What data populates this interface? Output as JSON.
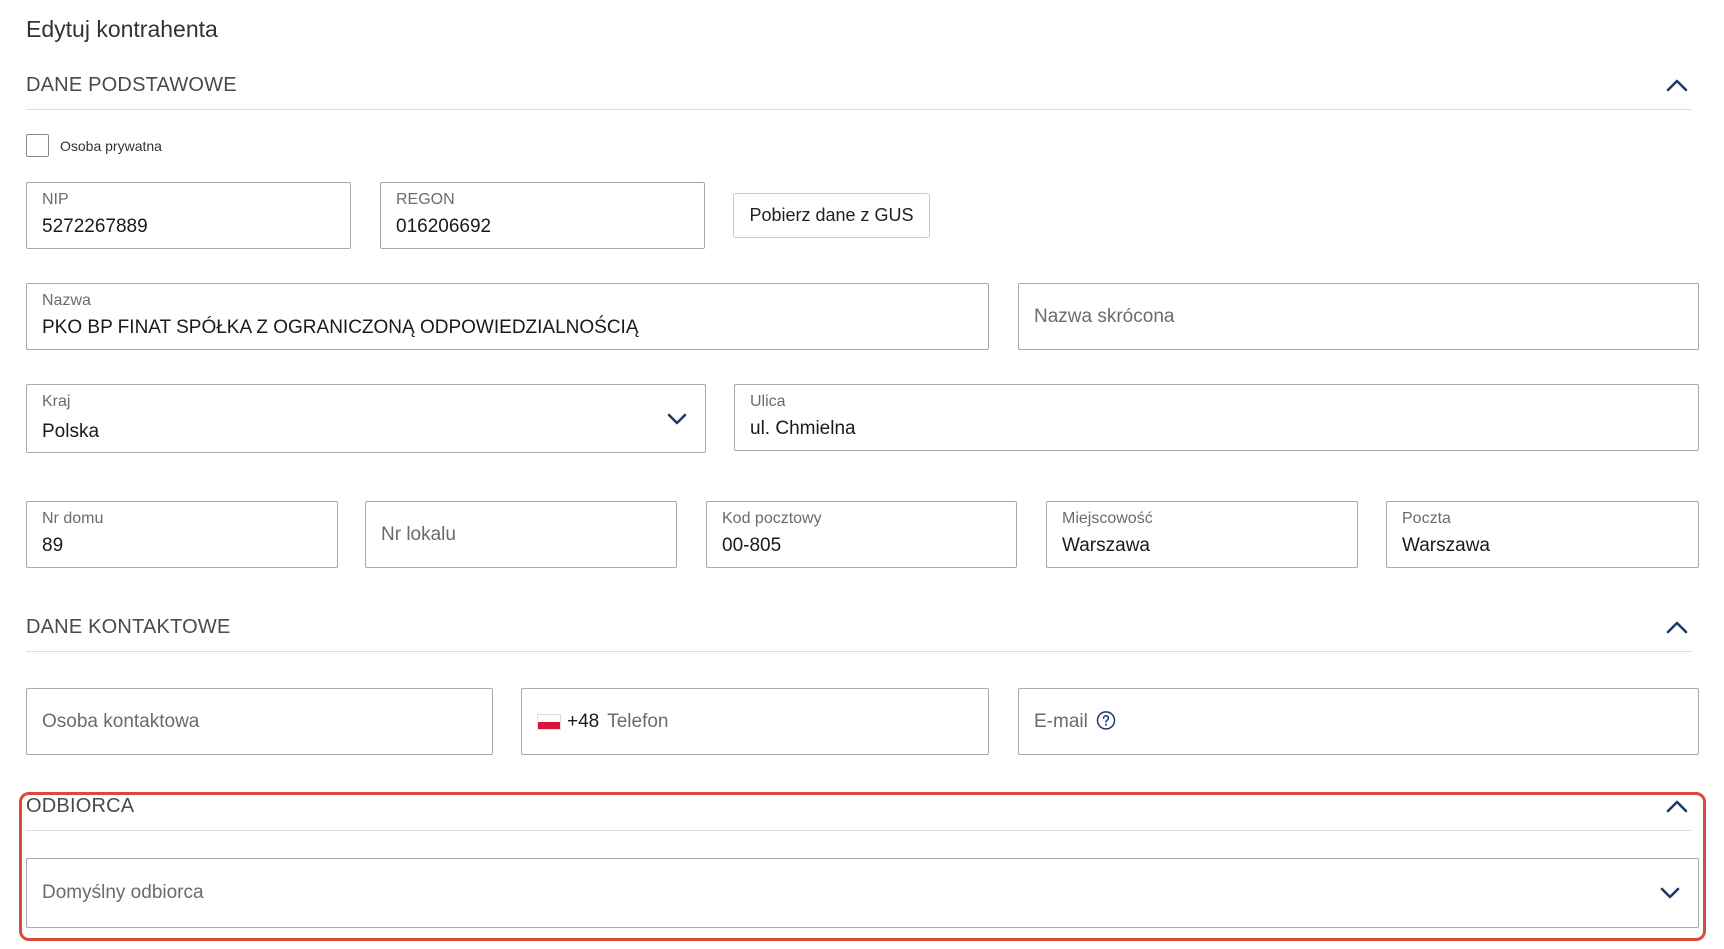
{
  "page": {
    "title": "Edytuj kontrahenta"
  },
  "sections": {
    "basic": {
      "label": "DANE PODSTAWOWE"
    },
    "contact": {
      "label": "DANE KONTAKTOWE"
    },
    "recipient": {
      "label": "ODBIORCA"
    }
  },
  "private_person": {
    "label": "Osoba prywatna",
    "checked": false
  },
  "fields": {
    "nip": {
      "label": "NIP",
      "value": "5272267889"
    },
    "regon": {
      "label": "REGON",
      "value": "016206692"
    },
    "nazwa": {
      "label": "Nazwa",
      "value": "PKO BP FINAT SPÓŁKA Z OGRANICZONĄ ODPOWIEDZIALNOŚCIĄ"
    },
    "nazwa_skrocona": {
      "placeholder": "Nazwa skrócona"
    },
    "kraj": {
      "label": "Kraj",
      "value": "Polska"
    },
    "ulica": {
      "label": "Ulica",
      "value": "ul. Chmielna"
    },
    "nr_domu": {
      "label": "Nr domu",
      "value": "89"
    },
    "nr_lokalu": {
      "placeholder": "Nr lokalu"
    },
    "kod_pocztowy": {
      "label": "Kod pocztowy",
      "value": "00-805"
    },
    "miejscowosc": {
      "label": "Miejscowość",
      "value": "Warszawa"
    },
    "poczta": {
      "label": "Poczta",
      "value": "Warszawa"
    },
    "osoba_kontaktowa": {
      "placeholder": "Osoba kontaktowa"
    },
    "telefon": {
      "prefix": "+48",
      "placeholder": "Telefon"
    },
    "email": {
      "placeholder": "E-mail"
    },
    "odbiorca": {
      "placeholder": "Domyślny odbiorca"
    }
  },
  "buttons": {
    "gus": "Pobierz dane z GUS"
  },
  "icons": {
    "section_toggle": "chevron-up-icon",
    "dropdown": "chevron-down-icon",
    "help": "help-circle-icon",
    "flag": "poland-flag-icon"
  },
  "colors": {
    "accent": "#1a3a6b",
    "highlight": "#d94a3d",
    "flag_red": "#dc143c"
  }
}
